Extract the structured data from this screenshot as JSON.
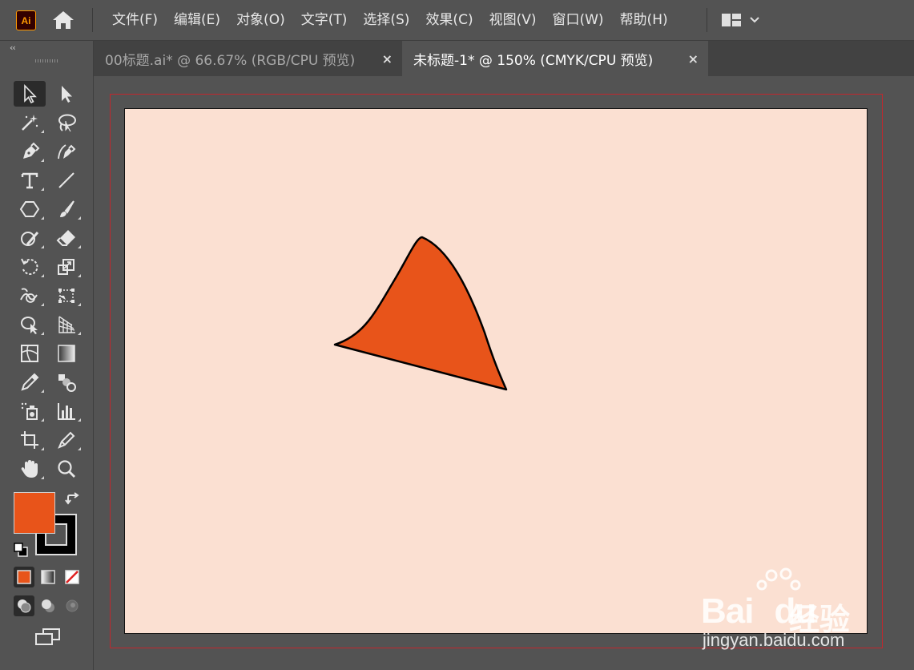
{
  "app": {
    "logo_text": "Ai",
    "brand_color": "#ff9a00"
  },
  "menu": {
    "items": [
      {
        "label": "文件(F)"
      },
      {
        "label": "编辑(E)"
      },
      {
        "label": "对象(O)"
      },
      {
        "label": "文字(T)"
      },
      {
        "label": "选择(S)"
      },
      {
        "label": "效果(C)"
      },
      {
        "label": "视图(V)"
      },
      {
        "label": "窗口(W)"
      },
      {
        "label": "帮助(H)"
      }
    ]
  },
  "tabs": [
    {
      "title": "00标题.ai* @ 66.67% (RGB/CPU 预览)",
      "close": "×",
      "active": false
    },
    {
      "title": "未标题-1* @ 150% (CMYK/CPU 预览)",
      "close": "×",
      "active": true
    }
  ],
  "toolbar": {
    "collapse": "‹‹",
    "tools": [
      "selection-tool",
      "direct-selection-tool",
      "magic-wand-tool",
      "lasso-tool",
      "pen-tool",
      "curvature-tool",
      "type-tool",
      "line-segment-tool",
      "polygon-tool",
      "paintbrush-tool",
      "shaper-tool",
      "eraser-tool",
      "rotate-tool",
      "scale-tool",
      "warp-tool",
      "free-transform-tool",
      "shape-builder-tool",
      "perspective-grid-tool",
      "mesh-tool",
      "gradient-tool",
      "eyedropper-tool",
      "blend-tool",
      "symbol-sprayer-tool",
      "column-graph-tool",
      "artboard-tool",
      "slice-tool",
      "hand-tool",
      "zoom-tool"
    ],
    "active_tool": "selection-tool"
  },
  "colors": {
    "fill": "#e8541a",
    "stroke": "#000000",
    "canvas_bg": "#fbe0d2",
    "bleed": "#c1272d"
  },
  "watermark": {
    "brand": "Bai",
    "brand2": "du",
    "suffix": "经验",
    "url": "jingyan.baidu.com"
  }
}
